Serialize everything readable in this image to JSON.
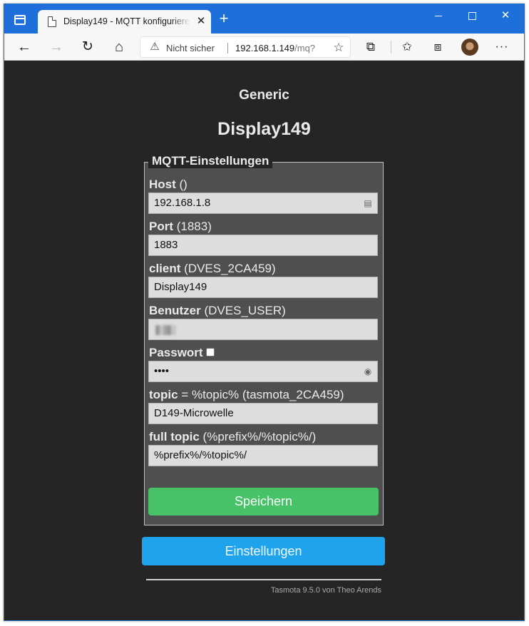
{
  "browser": {
    "tab_title": "Display149 - MQTT konfigurieren",
    "tab_close": "✕",
    "new_tab": "+",
    "window_controls": {
      "minimize": "",
      "maximize": "",
      "close": "✕"
    },
    "address": {
      "security_label": "Nicht sicher",
      "host": "192.168.1.149",
      "path": "/mq?"
    },
    "icons": [
      "tab-actions-icon",
      "page-icon",
      "back-icon",
      "forward-icon",
      "reload-icon",
      "home-icon",
      "warning-icon",
      "add-favorite-icon",
      "extensions-icon",
      "favorites-icon",
      "collections-icon",
      "avatar",
      "more-icon"
    ]
  },
  "page": {
    "module": "Generic",
    "device_name": "Display149",
    "fieldset_legend": "MQTT-Einstellungen",
    "fields": [
      {
        "label": "Host",
        "hint": " ()",
        "value": ""
      },
      {
        "label": "Port",
        "hint": " (1883)",
        "value": "1883"
      },
      {
        "label": "client",
        "hint": " (DVES_2CA459)",
        "value": "Display149"
      },
      {
        "label": "Benutzer",
        "hint": " (DVES_USER)",
        "value": ""
      },
      {
        "label": "Passwort",
        "hint": "",
        "value": "••••"
      },
      {
        "label": "topic",
        "hint": " = %topic% (tasmota_2CA459)",
        "value": "D149-Microwelle"
      },
      {
        "label": "full topic",
        "hint": " (%prefix%/%topic%/)",
        "value": "%prefix%/%topic%/"
      }
    ],
    "host_value": "192.168.1.8",
    "save_button": "Speichern",
    "settings_button": "Einstellungen",
    "footer": "Tasmota 9.5.0 von Theo Arends"
  },
  "colors": {
    "page_bg": "#252525",
    "fieldset_bg": "#4f4f4f",
    "save_green": "#47c266",
    "settings_blue": "#1fa3ec",
    "browser_accent": "#1e6fd9"
  }
}
